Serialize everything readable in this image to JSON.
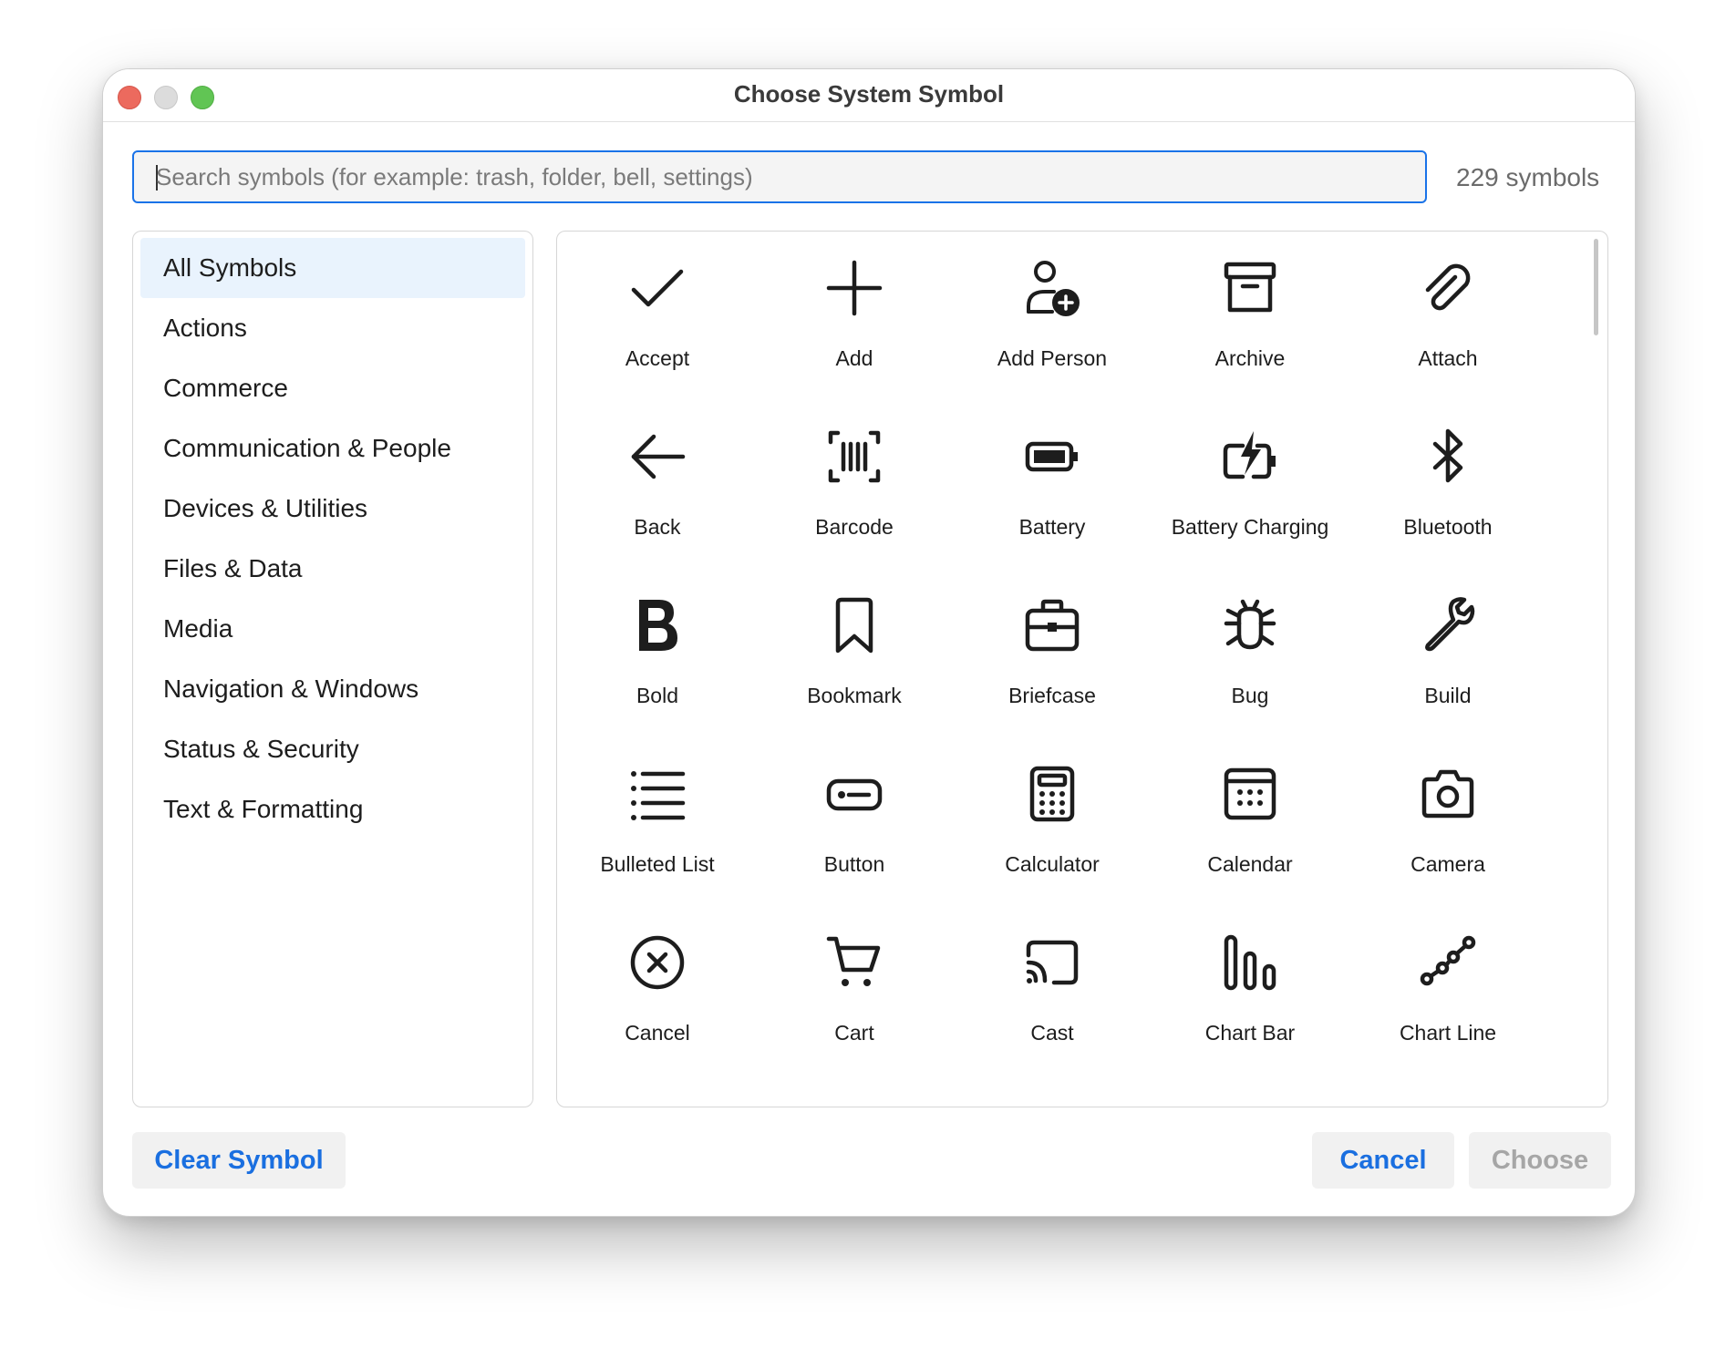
{
  "window": {
    "title": "Choose System Symbol"
  },
  "search": {
    "placeholder": "Search symbols (for example: trash, folder, bell, settings)",
    "value": "",
    "count_text": "229 symbols"
  },
  "categories": [
    {
      "label": "All Symbols",
      "selected": true
    },
    {
      "label": "Actions",
      "selected": false
    },
    {
      "label": "Commerce",
      "selected": false
    },
    {
      "label": "Communication & People",
      "selected": false
    },
    {
      "label": "Devices & Utilities",
      "selected": false
    },
    {
      "label": "Files & Data",
      "selected": false
    },
    {
      "label": "Media",
      "selected": false
    },
    {
      "label": "Navigation & Windows",
      "selected": false
    },
    {
      "label": "Status & Security",
      "selected": false
    },
    {
      "label": "Text & Formatting",
      "selected": false
    }
  ],
  "symbols": [
    {
      "label": "Accept",
      "icon": "checkmark-icon"
    },
    {
      "label": "Add",
      "icon": "plus-icon"
    },
    {
      "label": "Add Person",
      "icon": "person-add-icon"
    },
    {
      "label": "Archive",
      "icon": "archive-box-icon"
    },
    {
      "label": "Attach",
      "icon": "paperclip-icon"
    },
    {
      "label": "Back",
      "icon": "arrow-left-icon"
    },
    {
      "label": "Barcode",
      "icon": "barcode-icon"
    },
    {
      "label": "Battery",
      "icon": "battery-icon"
    },
    {
      "label": "Battery Charging",
      "icon": "battery-charging-icon"
    },
    {
      "label": "Bluetooth",
      "icon": "bluetooth-icon"
    },
    {
      "label": "Bold",
      "icon": "bold-icon"
    },
    {
      "label": "Bookmark",
      "icon": "bookmark-icon"
    },
    {
      "label": "Briefcase",
      "icon": "briefcase-icon"
    },
    {
      "label": "Bug",
      "icon": "bug-icon"
    },
    {
      "label": "Build",
      "icon": "wrench-icon"
    },
    {
      "label": "Bulleted List",
      "icon": "bulleted-list-icon"
    },
    {
      "label": "Button",
      "icon": "button-icon"
    },
    {
      "label": "Calculator",
      "icon": "calculator-icon"
    },
    {
      "label": "Calendar",
      "icon": "calendar-icon"
    },
    {
      "label": "Camera",
      "icon": "camera-icon"
    },
    {
      "label": "Cancel",
      "icon": "cancel-circle-icon"
    },
    {
      "label": "Cart",
      "icon": "cart-icon"
    },
    {
      "label": "Cast",
      "icon": "cast-icon"
    },
    {
      "label": "Chart Bar",
      "icon": "chart-bar-icon"
    },
    {
      "label": "Chart Line",
      "icon": "chart-line-icon"
    }
  ],
  "footer": {
    "clear_label": "Clear Symbol",
    "cancel_label": "Cancel",
    "choose_label": "Choose"
  },
  "colors": {
    "accent": "#1a6fe0",
    "selection": "#e9f3fd",
    "close": "#ec6a5e",
    "minimize": "#dcdcdc",
    "maximize": "#61c554"
  }
}
